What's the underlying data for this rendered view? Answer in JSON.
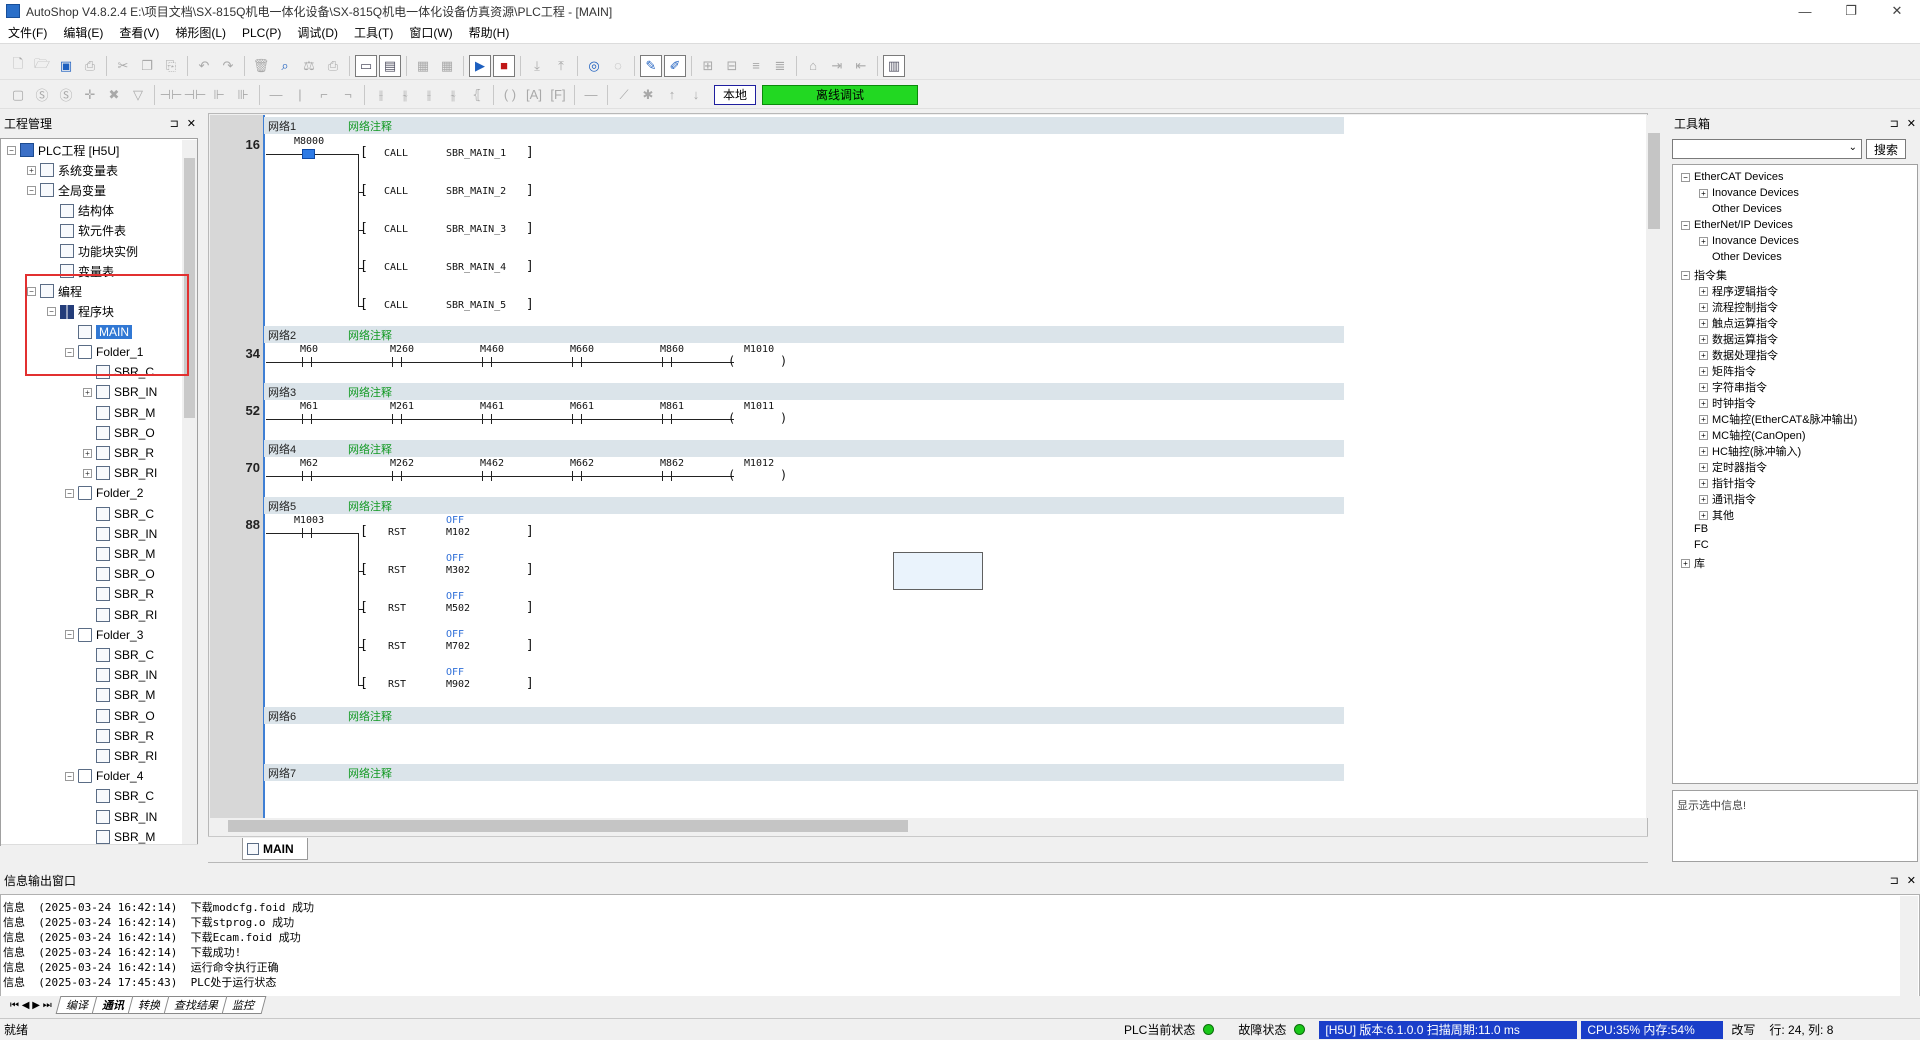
{
  "window": {
    "title": "AutoShop V4.8.2.4  E:\\项目文档\\SX-815Q机电一体化设备\\SX-815Q机电一体化设备仿真资源\\PLC工程 - [MAIN]",
    "minimize": "—",
    "restore": "❐",
    "close": "✕"
  },
  "menu": [
    "文件(F)",
    "编辑(E)",
    "查看(V)",
    "梯形图(L)",
    "PLC(P)",
    "调试(D)",
    "工具(T)",
    "窗口(W)",
    "帮助(H)"
  ],
  "toolbar2": {
    "local_label": "本地",
    "offline_label": "离线调试"
  },
  "project_panel": {
    "title": "工程管理",
    "pin": "⊐",
    "close": "✕",
    "tree": [
      {
        "label": "PLC工程 [H5U]",
        "level": 0,
        "exp": "−",
        "icon": "pc"
      },
      {
        "label": "系统变量表",
        "level": 1,
        "exp": "+",
        "icon": "doc"
      },
      {
        "label": "全局变量",
        "level": 1,
        "exp": "−",
        "icon": "doc"
      },
      {
        "label": "结构体",
        "level": 2,
        "exp": "",
        "icon": "doc"
      },
      {
        "label": "软元件表",
        "level": 2,
        "exp": "",
        "icon": "doc"
      },
      {
        "label": "功能块实例",
        "level": 2,
        "exp": "",
        "icon": "doc"
      },
      {
        "label": "变量表",
        "level": 2,
        "exp": "",
        "icon": "doc"
      },
      {
        "label": "编程",
        "level": 1,
        "exp": "−",
        "icon": "doc"
      },
      {
        "label": "程序块",
        "level": 2,
        "exp": "−",
        "icon": "grid"
      },
      {
        "label": "MAIN",
        "level": 3,
        "exp": "",
        "icon": "doc",
        "selected": true
      },
      {
        "label": "Folder_1",
        "level": 3,
        "exp": "−",
        "icon": "folder"
      },
      {
        "label": "SBR_C",
        "level": 4,
        "exp": "",
        "icon": "doc"
      },
      {
        "label": "SBR_IN",
        "level": 4,
        "exp": "+",
        "icon": "doc"
      },
      {
        "label": "SBR_M",
        "level": 4,
        "exp": "",
        "icon": "doc"
      },
      {
        "label": "SBR_O",
        "level": 4,
        "exp": "",
        "icon": "doc"
      },
      {
        "label": "SBR_R",
        "level": 4,
        "exp": "+",
        "icon": "doc"
      },
      {
        "label": "SBR_RI",
        "level": 4,
        "exp": "+",
        "icon": "doc"
      },
      {
        "label": "Folder_2",
        "level": 3,
        "exp": "−",
        "icon": "folder"
      },
      {
        "label": "SBR_C",
        "level": 4,
        "exp": "",
        "icon": "doc"
      },
      {
        "label": "SBR_IN",
        "level": 4,
        "exp": "",
        "icon": "doc"
      },
      {
        "label": "SBR_M",
        "level": 4,
        "exp": "",
        "icon": "doc"
      },
      {
        "label": "SBR_O",
        "level": 4,
        "exp": "",
        "icon": "doc"
      },
      {
        "label": "SBR_R",
        "level": 4,
        "exp": "",
        "icon": "doc"
      },
      {
        "label": "SBR_RI",
        "level": 4,
        "exp": "",
        "icon": "doc"
      },
      {
        "label": "Folder_3",
        "level": 3,
        "exp": "−",
        "icon": "folder"
      },
      {
        "label": "SBR_C",
        "level": 4,
        "exp": "",
        "icon": "doc"
      },
      {
        "label": "SBR_IN",
        "level": 4,
        "exp": "",
        "icon": "doc"
      },
      {
        "label": "SBR_M",
        "level": 4,
        "exp": "",
        "icon": "doc"
      },
      {
        "label": "SBR_O",
        "level": 4,
        "exp": "",
        "icon": "doc"
      },
      {
        "label": "SBR_R",
        "level": 4,
        "exp": "",
        "icon": "doc"
      },
      {
        "label": "SBR_RI",
        "level": 4,
        "exp": "",
        "icon": "doc"
      },
      {
        "label": "Folder_4",
        "level": 3,
        "exp": "−",
        "icon": "folder"
      },
      {
        "label": "SBR_C",
        "level": 4,
        "exp": "",
        "icon": "doc"
      },
      {
        "label": "SBR_IN",
        "level": 4,
        "exp": "",
        "icon": "doc"
      },
      {
        "label": "SBR_M",
        "level": 4,
        "exp": "",
        "icon": "doc"
      }
    ]
  },
  "editor": {
    "tab_label": "MAIN",
    "networks": [
      {
        "name": "网络1",
        "comment": "网络注释",
        "step": "16"
      },
      {
        "name": "网络2",
        "comment": "网络注释",
        "step": "34"
      },
      {
        "name": "网络3",
        "comment": "网络注释",
        "step": "52"
      },
      {
        "name": "网络4",
        "comment": "网络注释",
        "step": "70"
      },
      {
        "name": "网络5",
        "comment": "网络注释",
        "step": "88"
      },
      {
        "name": "网络6",
        "comment": "网络注释",
        "step": ""
      },
      {
        "name": "网络7",
        "comment": "网络注释",
        "step": ""
      }
    ],
    "net1": {
      "contact": "M8000",
      "calls": [
        {
          "op": "CALL",
          "arg": "SBR_MAIN_1"
        },
        {
          "op": "CALL",
          "arg": "SBR_MAIN_2"
        },
        {
          "op": "CALL",
          "arg": "SBR_MAIN_3"
        },
        {
          "op": "CALL",
          "arg": "SBR_MAIN_4"
        },
        {
          "op": "CALL",
          "arg": "SBR_MAIN_5"
        }
      ]
    },
    "net2": {
      "contacts": [
        "M60",
        "M260",
        "M460",
        "M660",
        "M860"
      ],
      "coil": "M1010"
    },
    "net3": {
      "contacts": [
        "M61",
        "M261",
        "M461",
        "M661",
        "M861"
      ],
      "coil": "M1011"
    },
    "net4": {
      "contacts": [
        "M62",
        "M262",
        "M462",
        "M662",
        "M862"
      ],
      "coil": "M1012"
    },
    "net5": {
      "contact": "M1003",
      "rsts": [
        {
          "op": "RST",
          "state": "OFF",
          "arg": "M102"
        },
        {
          "op": "RST",
          "state": "OFF",
          "arg": "M302"
        },
        {
          "op": "RST",
          "state": "OFF",
          "arg": "M502"
        },
        {
          "op": "RST",
          "state": "OFF",
          "arg": "M702"
        },
        {
          "op": "RST",
          "state": "OFF",
          "arg": "M902"
        }
      ]
    }
  },
  "toolbox": {
    "title": "工具箱",
    "search_label": "搜索",
    "info": "显示选中信息!",
    "items": [
      {
        "label": "EtherCAT Devices",
        "level": 0,
        "exp": "−"
      },
      {
        "label": "Inovance Devices",
        "level": 1,
        "exp": "+"
      },
      {
        "label": "Other Devices",
        "level": 1,
        "exp": ""
      },
      {
        "label": "EtherNet/IP Devices",
        "level": 0,
        "exp": "−"
      },
      {
        "label": "Inovance Devices",
        "level": 1,
        "exp": "+"
      },
      {
        "label": "Other Devices",
        "level": 1,
        "exp": ""
      },
      {
        "label": "指令集",
        "level": 0,
        "exp": "−"
      },
      {
        "label": "程序逻辑指令",
        "level": 1,
        "exp": "+"
      },
      {
        "label": "流程控制指令",
        "level": 1,
        "exp": "+"
      },
      {
        "label": "触点运算指令",
        "level": 1,
        "exp": "+"
      },
      {
        "label": "数据运算指令",
        "level": 1,
        "exp": "+"
      },
      {
        "label": "数据处理指令",
        "level": 1,
        "exp": "+"
      },
      {
        "label": "矩阵指令",
        "level": 1,
        "exp": "+"
      },
      {
        "label": "字符串指令",
        "level": 1,
        "exp": "+"
      },
      {
        "label": "时钟指令",
        "level": 1,
        "exp": "+"
      },
      {
        "label": "MC轴控(EtherCAT&脉冲输出)",
        "level": 1,
        "exp": "+"
      },
      {
        "label": "MC轴控(CanOpen)",
        "level": 1,
        "exp": "+"
      },
      {
        "label": "HC轴控(脉冲输入)",
        "level": 1,
        "exp": "+"
      },
      {
        "label": "定时器指令",
        "level": 1,
        "exp": "+"
      },
      {
        "label": "指针指令",
        "level": 1,
        "exp": "+"
      },
      {
        "label": "通讯指令",
        "level": 1,
        "exp": "+"
      },
      {
        "label": "其他",
        "level": 1,
        "exp": "+"
      },
      {
        "label": "FB",
        "level": 0,
        "exp": ""
      },
      {
        "label": "FC",
        "level": 0,
        "exp": ""
      },
      {
        "label": "库",
        "level": 0,
        "exp": "+"
      }
    ]
  },
  "output": {
    "title": "信息输出窗口",
    "lines": [
      "信息  (2025-03-24 16:42:14)  下载modcfg.foid 成功",
      "信息  (2025-03-24 16:42:14)  下载stprog.o 成功",
      "信息  (2025-03-24 16:42:14)  下载Ecam.foid 成功",
      "信息  (2025-03-24 16:42:14)  下载成功!",
      "信息  (2025-03-24 16:42:14)  运行命令执行正确",
      "信息  (2025-03-24 17:45:43)  PLC处于运行状态"
    ],
    "tabs": [
      "编译",
      "通讯",
      "转换",
      "查找结果",
      "监控"
    ],
    "active_tab": "通讯"
  },
  "statusbar": {
    "ready": "就绪",
    "plc_state": "PLC当前状态",
    "fault_state": "故障状态",
    "version": "[H5U] 版本:6.1.0.0 扫描周期:11.0 ms",
    "cpu": "CPU:35% 内存:54%",
    "mode": "改写",
    "pos": "行:  24, 列:   8"
  },
  "colors": {
    "accent": "#3178d4",
    "offline_green": "#22d822",
    "net_comment": "#119922",
    "off_blue": "#2f6fd8",
    "highlight_red": "#e23030"
  }
}
